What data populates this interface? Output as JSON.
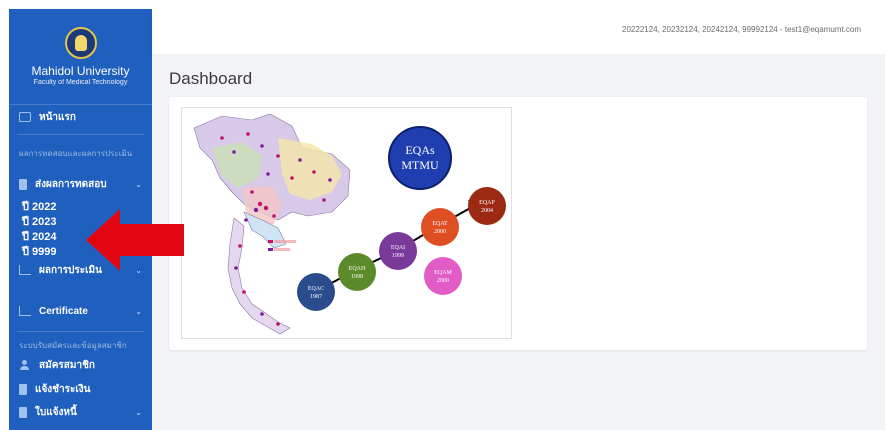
{
  "sidebar": {
    "brand_title": "Mahidol University",
    "brand_subtitle": "Faculty of Medical Technology",
    "home_label": "หน้าแรก",
    "section_results": "ผลการทดสอบและผลการประเมิน",
    "submit_results": "ส่งผลการทดสอบ",
    "years": [
      "ปี 2022",
      "ปี 2023",
      "ปี 2024",
      "ปี 9999"
    ],
    "evaluation": "ผลการประเมิน",
    "certificate": "Certificate",
    "section_membership": "ระบบรับสมัครและข้อมูลสมาชิก",
    "register": "สมัครสมาชิก",
    "payment_notice": "แจ้งชำระเงิน",
    "invoice": "ใบแจ้งหนี้"
  },
  "topbar": {
    "user_info": "20222124, 20232124, 20242124, 99992124 - test1@eqamumt.com"
  },
  "main": {
    "title": "Dashboard",
    "image": {
      "badge_line1": "EQAs",
      "badge_line2": "MTMU",
      "circles": [
        {
          "name": "EQAC",
          "year": "1987",
          "color": "#2b4c8c"
        },
        {
          "name": "EQAH",
          "year": "1998",
          "color": "#5a8a2a"
        },
        {
          "name": "EQAI",
          "year": "1999",
          "color": "#7a3a9a"
        },
        {
          "name": "EQAT",
          "year": "2000",
          "color": "#e04f24"
        },
        {
          "name": "EQAP",
          "year": "2004",
          "color": "#9c2a12"
        },
        {
          "name": "EQAM",
          "year": "2000",
          "color": "#e25bc6"
        }
      ]
    }
  },
  "colors": {
    "sidebar": "#1f5fbe",
    "arrow": "#e30613"
  }
}
